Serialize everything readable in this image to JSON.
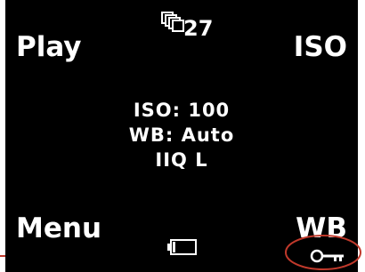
{
  "screen": {
    "soft_keys": {
      "top_left": "Play",
      "top_right": "ISO",
      "bottom_left": "Menu",
      "bottom_right": "WB"
    },
    "shots_remaining": "27",
    "settings": {
      "iso": "ISO: 100",
      "wb": "WB: Auto",
      "format": "IIQ L"
    },
    "icons": {
      "frames": "frames-stack-icon",
      "battery": "battery-icon",
      "key": "key-lock-icon"
    },
    "battery_level": 0.12
  },
  "colors": {
    "background": "#000000",
    "text": "#ffffff",
    "annotation": "#c0392b"
  }
}
